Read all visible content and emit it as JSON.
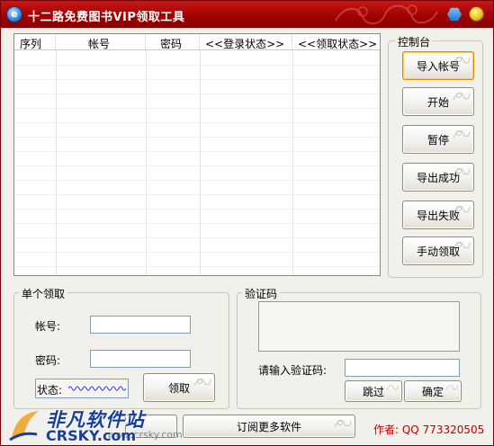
{
  "window": {
    "title": "十二路免费图书VIP领取工具",
    "title_color": "#9e0000"
  },
  "account_list": {
    "columns": [
      "序列",
      "帐号",
      "密码",
      "<<登录状态>>",
      "<<领取状态>>"
    ],
    "rows": []
  },
  "control_panel": {
    "label": "控制台",
    "buttons": {
      "import": "导入帐号",
      "start": "开始",
      "pause": "暂停",
      "export_success": "导出成功",
      "export_fail": "导出失败",
      "manual": "手动领取"
    }
  },
  "single": {
    "label": "单个领取",
    "account_label": "帐号:",
    "account_value": "",
    "password_label": "密码:",
    "password_value": "",
    "status_label": "状态:",
    "claim_button": "领取"
  },
  "captcha": {
    "label": "验证码",
    "input_label": "请输入验证码:",
    "input_value": "",
    "skip_button": "跳过",
    "confirm_button": "确定"
  },
  "footer": {
    "subscribe_button": "订阅更多软件",
    "author": "作者: QQ 773320505"
  },
  "watermark": {
    "cn": "非凡软件站",
    "en": "CRSKY.com",
    "url": "www.crsky.com"
  }
}
